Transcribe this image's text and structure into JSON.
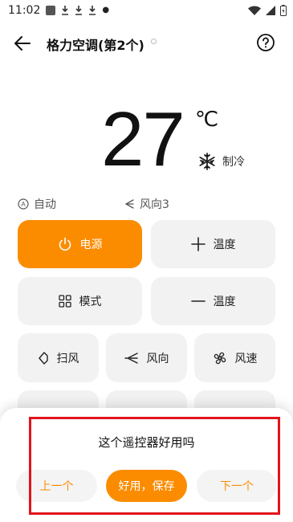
{
  "status_bar": {
    "time": "11:02"
  },
  "header": {
    "title": "格力空调(第2个)"
  },
  "display": {
    "temperature": "27",
    "unit": "℃",
    "mode": "制冷"
  },
  "status_row": {
    "auto": "自动",
    "wind_dir": "风向3"
  },
  "buttons": {
    "power": "电源",
    "temp_up": "温度",
    "mode": "模式",
    "temp_down": "温度",
    "sweep": "扫风",
    "direction": "风向",
    "speed": "风速"
  },
  "sheet": {
    "question": "这个遥控器好用吗",
    "prev": "上一个",
    "save": "好用，保存",
    "next": "下一个"
  },
  "colors": {
    "accent": "#fb8c00",
    "highlight_box": "#e1141b"
  }
}
